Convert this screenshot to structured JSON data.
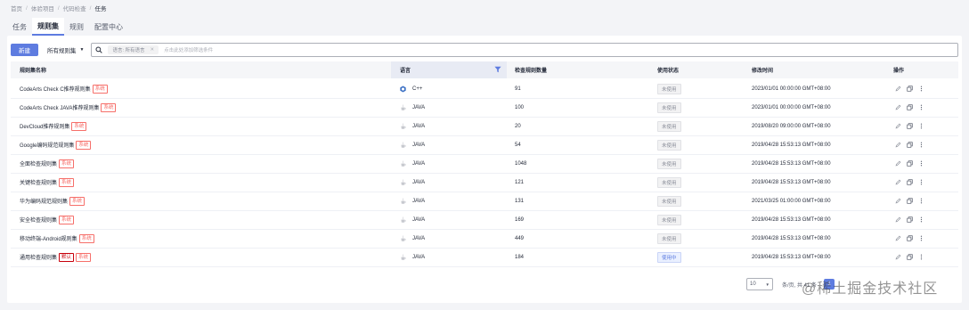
{
  "breadcrumb": {
    "items": [
      "首页",
      "体验项目",
      "代码检查"
    ],
    "current": "任务"
  },
  "tabs": [
    "任务",
    "规则集",
    "规则",
    "配置中心"
  ],
  "toolbar": {
    "new_label": "新建",
    "filter_label": "所有规则集",
    "chip_label": "语言: 所有语言",
    "search_placeholder": "点击此处添加筛选条件"
  },
  "table": {
    "headers": [
      "规则集名称",
      "语言",
      "检查规则数量",
      "使用状态",
      "修改时间",
      "操作"
    ],
    "rows": [
      {
        "name": "CodeArts Check C推荐规则集",
        "tags": [
          "系统"
        ],
        "lang": "C++",
        "lang_icon": "cpp-hex-icon",
        "count": "91",
        "status": "未使用",
        "time": "2023/01/01 00:00:00 GMT+08:00"
      },
      {
        "name": "CodeArts Check JAVA推荐规则集",
        "tags": [
          "系统"
        ],
        "lang": "JAVA",
        "lang_icon": "java-cup-icon",
        "count": "100",
        "status": "未使用",
        "time": "2023/01/01 00:00:00 GMT+08:00"
      },
      {
        "name": "DevCloud推荐规则集",
        "tags": [
          "系统"
        ],
        "lang": "JAVA",
        "lang_icon": "java-cup-icon",
        "count": "20",
        "status": "未使用",
        "time": "2019/08/20 09:00:00 GMT+08:00"
      },
      {
        "name": "Google编码规范规则集",
        "tags": [
          "系统"
        ],
        "lang": "JAVA",
        "lang_icon": "java-cup-icon",
        "count": "54",
        "status": "未使用",
        "time": "2019/04/28 15:53:13 GMT+08:00"
      },
      {
        "name": "全面检查规则集",
        "tags": [
          "系统"
        ],
        "lang": "JAVA",
        "lang_icon": "java-cup-icon",
        "count": "1048",
        "status": "未使用",
        "time": "2019/04/28 15:53:13 GMT+08:00"
      },
      {
        "name": "关键检查规则集",
        "tags": [
          "系统"
        ],
        "lang": "JAVA",
        "lang_icon": "java-cup-icon",
        "count": "121",
        "status": "未使用",
        "time": "2019/04/28 15:53:13 GMT+08:00"
      },
      {
        "name": "华为编码规范规则集",
        "tags": [
          "系统"
        ],
        "lang": "JAVA",
        "lang_icon": "java-cup-icon",
        "count": "131",
        "status": "未使用",
        "time": "2021/03/25 01:00:00 GMT+08:00"
      },
      {
        "name": "安全检查规则集",
        "tags": [
          "系统"
        ],
        "lang": "JAVA",
        "lang_icon": "java-cup-icon",
        "count": "169",
        "status": "未使用",
        "time": "2019/04/28 15:53:13 GMT+08:00"
      },
      {
        "name": "移动终端-Android规则集",
        "tags": [
          "系统"
        ],
        "lang": "JAVA",
        "lang_icon": "java-cup-icon",
        "count": "449",
        "status": "未使用",
        "time": "2019/04/28 15:53:13 GMT+08:00"
      },
      {
        "name": "通用检查规则集",
        "tags": [
          "默认",
          "系统"
        ],
        "lang": "JAVA",
        "lang_icon": "java-cup-icon",
        "count": "184",
        "status": "使用中",
        "time": "2019/04/28 15:53:13 GMT+08:00"
      }
    ]
  },
  "pagination": {
    "page_size": "10",
    "summary": "条/页, 共 41 条",
    "current": "1"
  },
  "watermark": "@稀土掘金技术社区",
  "colors": {
    "primary": "#5e7ce0",
    "tag": "#f66f6a",
    "default_tag": "#c7000b"
  }
}
